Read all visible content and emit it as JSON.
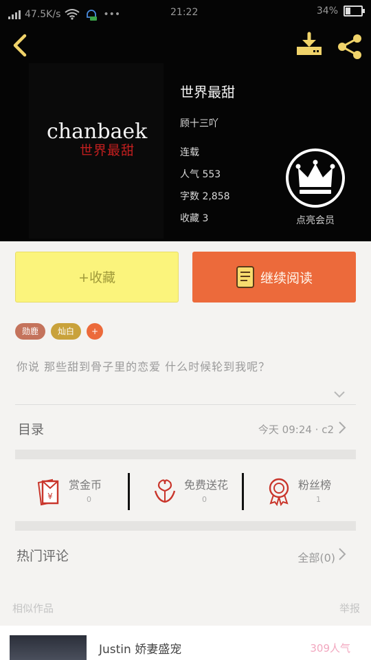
{
  "status_bar": {
    "speed": "47.5K/s",
    "time": "21:22",
    "battery": "34%"
  },
  "book": {
    "cover_title_en": "chanbaek",
    "cover_title_cn": "世界最甜",
    "title": "世界最甜",
    "author": "顾十三吖",
    "status": "连载",
    "popularity": "人气 553",
    "word_count": "字数 2,858",
    "favorites": "收藏 3"
  },
  "vip": {
    "label": "点亮会员"
  },
  "buttons": {
    "favorite": "+收藏",
    "continue_reading": "继续阅读"
  },
  "tags": [
    {
      "label": "勋鹿",
      "color": "#c4735c"
    },
    {
      "label": "灿白",
      "color": "#c9a23b"
    },
    {
      "label": "+",
      "color": "#ec6a3b"
    }
  ],
  "description": "你说 那些甜到骨子里的恋爱 什么时候轮到我呢？",
  "toc": {
    "label": "目录",
    "latest": "今天 09:24 · c2"
  },
  "actions": [
    {
      "label": "赏金币",
      "count": "0"
    },
    {
      "label": "免费送花",
      "count": "0"
    },
    {
      "label": "粉丝榜",
      "count": "1"
    }
  ],
  "comments": {
    "label": "热门评论",
    "all": "全部(0)"
  },
  "similar": {
    "label": "相似作品",
    "report": "举报"
  },
  "similar_book": {
    "title": "Justin 娇妻盛宠",
    "popularity": "309人气"
  },
  "colors": {
    "accent_yellow": "#fbf47c",
    "accent_orange": "#ec6a3b",
    "icon_gold": "#f0d36a",
    "icon_red": "#c9352b"
  }
}
